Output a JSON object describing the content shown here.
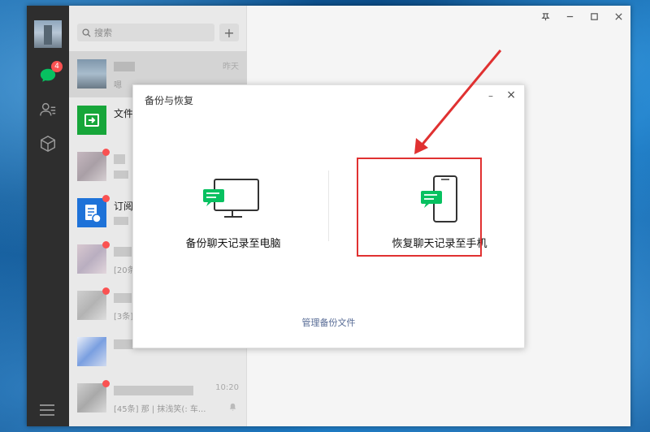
{
  "app": {
    "accent": "#07c160",
    "alert_red": "#fa5151",
    "annotation_red": "#e03131"
  },
  "rail": {
    "chat_badge": "4",
    "icons": [
      "chat-icon",
      "contacts-icon",
      "discover-cube-icon",
      "menu-icon"
    ]
  },
  "search": {
    "placeholder": "搜索",
    "add_label": "+"
  },
  "chats": [
    {
      "name": "",
      "preview": "嗯",
      "time": "昨天",
      "avatar": "photo"
    },
    {
      "name": "文件",
      "preview": "",
      "time": "",
      "avatar": "file-transfer"
    },
    {
      "name": "",
      "preview": "",
      "time": "",
      "avatar": "blurred"
    },
    {
      "name": "订阅",
      "preview": "",
      "time": "",
      "avatar": "subscription"
    },
    {
      "name": "",
      "preview": "[20条",
      "time": "",
      "avatar": "blurred"
    },
    {
      "name": "",
      "preview": "[3条]",
      "time": "",
      "avatar": "blurred"
    },
    {
      "name": "",
      "preview": "",
      "time": "",
      "avatar": "blurred"
    },
    {
      "name": "",
      "preview": "[45条] 那 | 抹浅笑(: 车...",
      "time": "10:20",
      "avatar": "blurred"
    }
  ],
  "window_controls": [
    "pin",
    "minimize",
    "maximize",
    "close"
  ],
  "dialog": {
    "title": "备份与恢复",
    "minimize": "–",
    "close": "×",
    "backup_label": "备份聊天记录至电脑",
    "restore_label": "恢复聊天记录至手机",
    "manage_link": "管理备份文件"
  }
}
